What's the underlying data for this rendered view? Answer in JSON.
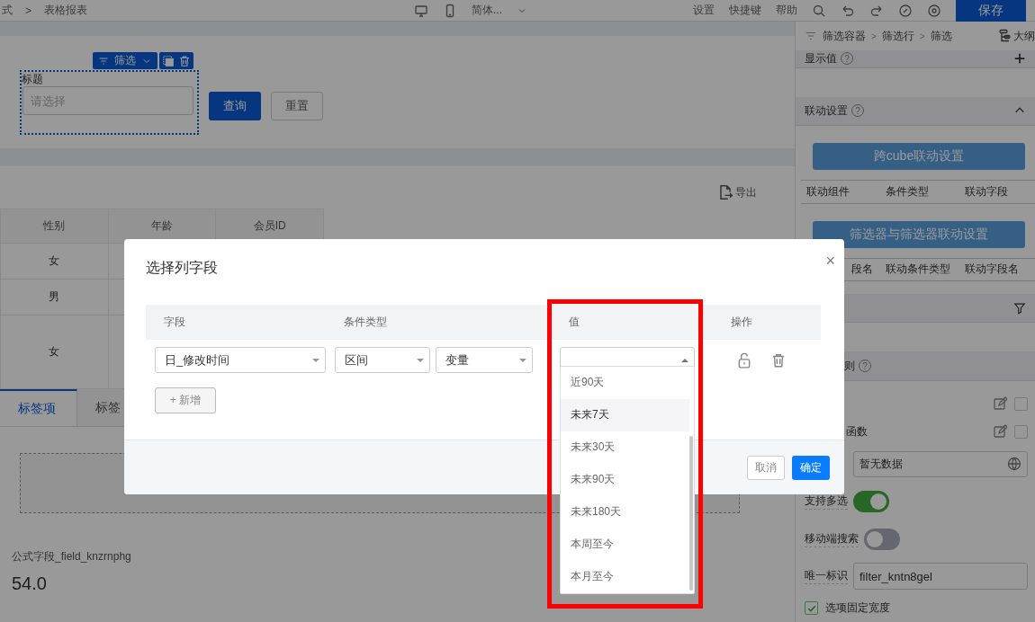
{
  "topbar": {
    "breadcrumb": [
      "式",
      "表格报表"
    ],
    "separator": ">",
    "language": "简体...",
    "menu": [
      "设置",
      "快捷键",
      "帮助"
    ],
    "save": "保存"
  },
  "filter_card": {
    "toolbar_label": "筛选",
    "field_label": "标题",
    "placeholder": "请选择",
    "buttons": [
      {
        "label": "查询",
        "kind": "primary"
      },
      {
        "label": "重置",
        "kind": "plain"
      }
    ]
  },
  "table_card": {
    "export": "导出",
    "columns": [
      "性别",
      "年龄",
      "会员ID"
    ],
    "rows": [
      [
        "女"
      ],
      [
        "男"
      ],
      [
        "女"
      ]
    ]
  },
  "tabs": [
    {
      "label": "标签项",
      "selected": true
    },
    {
      "label": "标签",
      "selected": false
    }
  ],
  "metric": {
    "label": "公式字段_field_knzrnphg",
    "value": "54.0"
  },
  "panel": {
    "breadcrumb": [
      "筛选容器",
      "筛选行",
      "筛选"
    ],
    "separator": ">",
    "help": "?",
    "outline": "大纲",
    "display_value": "显示值",
    "linkage": {
      "title": "联动设置",
      "expanded": true,
      "blocks": [
        {
          "button": "跨cube联动设置",
          "columns": [
            "联动组件",
            "条件类型",
            "联动字段"
          ]
        },
        {
          "button": "筛选器与筛选器联动设置",
          "columns": [
            "段名",
            "联动条件类型",
            "联动字段名"
          ]
        }
      ]
    },
    "rule_title": "则",
    "options": [
      {
        "checked": false
      },
      {
        "label": "函数",
        "checked": false
      }
    ],
    "select_placeholder": "暂无数据",
    "toggles": [
      {
        "label": "支持多选",
        "on": true
      },
      {
        "label": "移动端搜索",
        "on": false
      }
    ],
    "id_field": {
      "label": "唯一标识",
      "value": "filter_kntn8gel"
    },
    "fixed_width": {
      "label": "选项固定宽度",
      "checked": true
    }
  },
  "dialog": {
    "title": "选择列字段",
    "close": "×",
    "columns": [
      "字段",
      "条件类型",
      "值",
      "操作"
    ],
    "row": {
      "field": "日_修改时间",
      "condition": "区间",
      "type": "变量"
    },
    "add": "+ 新增",
    "cancel": "取消",
    "confirm": "确定",
    "dropdown": {
      "open": true,
      "options": [
        {
          "label": "近90天",
          "hovered": false
        },
        {
          "label": "未来7天",
          "hovered": true
        },
        {
          "label": "未来30天",
          "hovered": false
        },
        {
          "label": "未来90天",
          "hovered": false
        },
        {
          "label": "未来180天",
          "hovered": false
        },
        {
          "label": "本周至今",
          "hovered": false
        },
        {
          "label": "本月至今",
          "hovered": false
        }
      ]
    }
  }
}
